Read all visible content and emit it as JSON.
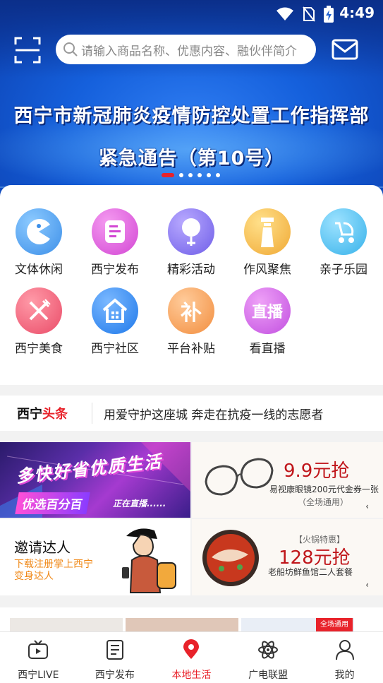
{
  "status_bar": {
    "time": "4:49"
  },
  "search": {
    "placeholder": "请输入商品名称、优惠内容、融伙伴简介"
  },
  "banner": {
    "line1": "西宁市新冠肺炎疫情防控处置工作指挥部",
    "line2": "紧急通告（第10号）",
    "page_count": 6,
    "active_page": 1
  },
  "grid": {
    "items": [
      {
        "label": "文体休闲",
        "icon": "pacman-icon",
        "color": "#5aa8f0"
      },
      {
        "label": "西宁发布",
        "icon": "document-icon",
        "color": "#e55fe0"
      },
      {
        "label": "精彩活动",
        "icon": "balloon-icon",
        "color": "#8a78f0"
      },
      {
        "label": "作风聚焦",
        "icon": "tower-icon",
        "color": "#f6c24e"
      },
      {
        "label": "亲子乐园",
        "icon": "stroller-icon",
        "color": "#55c8f0"
      },
      {
        "label": "西宁美食",
        "icon": "cutlery-icon",
        "color": "#f06a80"
      },
      {
        "label": "西宁社区",
        "icon": "house-icon",
        "color": "#3a8ff0"
      },
      {
        "label": "平台补贴",
        "icon": "subsidy-icon",
        "glyph": "补",
        "color": "#f6a860"
      },
      {
        "label": "看直播",
        "icon": "live-icon",
        "glyph": "直播",
        "color": "#d568e8"
      }
    ]
  },
  "headline": {
    "brand_a": "西宁",
    "brand_b": "头条",
    "text": "用爱守护这座城 奔走在抗疫一线的志愿者"
  },
  "promos": {
    "live": {
      "script": "多快好省优质生活",
      "tag": "优选百分百",
      "tag2": "正在直播......"
    },
    "glasses": {
      "price": "9.9元抢",
      "desc": "易视康眼镜200元代金券一张",
      "sub": "（全场通用）",
      "arrow": "‹"
    },
    "invite": {
      "title": "邀请达人",
      "sub1": "下载注册掌上西宁",
      "sub2": "变身达人"
    },
    "hotpot": {
      "badge": "【火锅特惠】",
      "price": "128元抢",
      "desc": "老船坊鲜鱼馆二人套餐",
      "arrow": "‹"
    }
  },
  "thumbs": {
    "badge": "全场通用"
  },
  "bottom_nav": {
    "items": [
      {
        "label": "西宁LIVE",
        "icon": "tv-icon",
        "active": false
      },
      {
        "label": "西宁发布",
        "icon": "news-icon",
        "active": false
      },
      {
        "label": "本地生活",
        "icon": "location-pin-icon",
        "active": true
      },
      {
        "label": "广电联盟",
        "icon": "atom-icon",
        "active": false
      },
      {
        "label": "我的",
        "icon": "person-icon",
        "active": false
      }
    ]
  },
  "colors": {
    "accent": "#e8222a",
    "banner_blue": "#1560dc",
    "orange": "#f08a1a"
  }
}
